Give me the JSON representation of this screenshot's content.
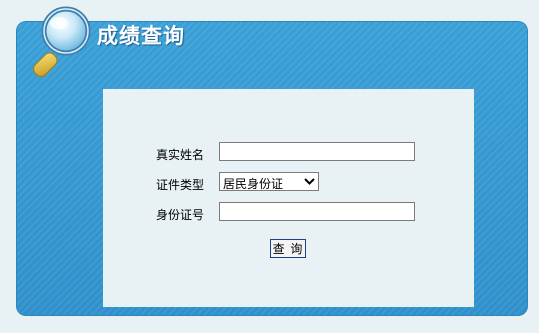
{
  "header": {
    "title": "成绩查询",
    "icon": "magnifier-icon"
  },
  "form": {
    "name_label": "真实姓名",
    "name_value": "",
    "id_type_label": "证件类型",
    "id_type_value": "居民身份证",
    "id_number_label": "身份证号",
    "id_number_value": "",
    "submit_label": "查 询"
  },
  "colors": {
    "panel_blue": "#3199d2",
    "content_bg": "#e8f1f4",
    "button_border": "#1f3e8c"
  }
}
